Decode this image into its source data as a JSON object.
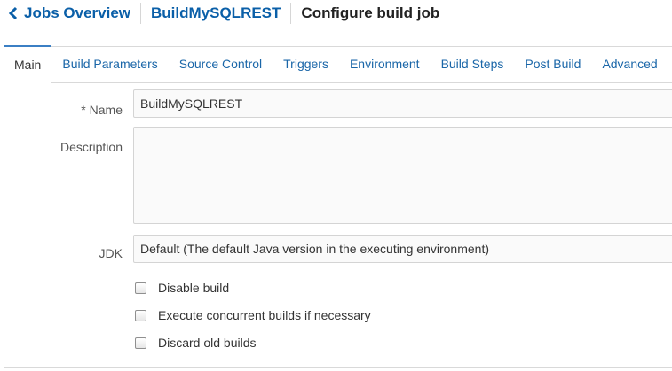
{
  "breadcrumb": {
    "back_icon": "chevron-left-icon",
    "jobs_overview": "Jobs Overview",
    "job_name": "BuildMySQLREST",
    "current": "Configure build job"
  },
  "tabs": [
    {
      "label": "Main",
      "active": true
    },
    {
      "label": "Build Parameters"
    },
    {
      "label": "Source Control"
    },
    {
      "label": "Triggers"
    },
    {
      "label": "Environment"
    },
    {
      "label": "Build Steps"
    },
    {
      "label": "Post Build"
    },
    {
      "label": "Advanced"
    }
  ],
  "form": {
    "name": {
      "required_marker": "*",
      "label": "Name",
      "value": "BuildMySQLREST"
    },
    "description": {
      "label": "Description",
      "value": ""
    },
    "jdk": {
      "label": "JDK",
      "selected": "Default (The default Java version in the executing environment)"
    },
    "checkboxes": [
      {
        "label": "Disable build",
        "checked": false
      },
      {
        "label": "Execute concurrent builds if necessary",
        "checked": false
      },
      {
        "label": "Discard old builds",
        "checked": false
      }
    ]
  },
  "colors": {
    "link": "#0a5fa8",
    "active_tab_border": "#3b7fc4"
  }
}
